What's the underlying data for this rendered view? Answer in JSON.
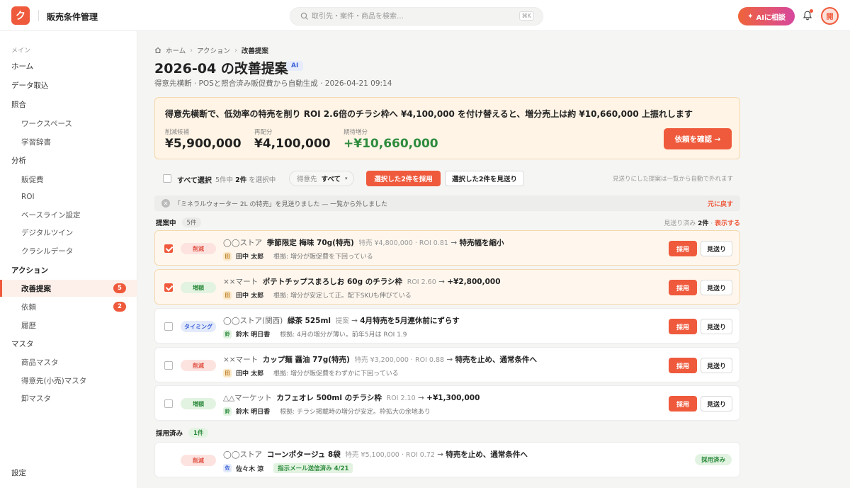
{
  "header": {
    "logo_letter": "ク",
    "app_title": "販売条件管理",
    "search_placeholder": "取引先・案件・商品を検索…",
    "search_kbd": "⌘K",
    "ai_label": "AIに相談",
    "avatar_letter": "開",
    "accent_color": "#ef5a3c"
  },
  "sidebar": {
    "section_main": "メイン",
    "home": "ホーム",
    "data_import": "データ取込",
    "match": "照合",
    "workspace": "ワークスペース",
    "dictionary": "学習辞書",
    "analysis": "分析",
    "promo": "販促費",
    "roi": "ROI",
    "baseline": "ベースライン設定",
    "digital_twin": "デジタルツイン",
    "kurashiru": "クラシルデータ",
    "action": "アクション",
    "improve": "改善提案",
    "improve_badge": "5",
    "request": "依頼",
    "request_badge": "2",
    "history": "履歴",
    "master": "マスタ",
    "product_master": "商品マスタ",
    "customer_master": "得意先(小売)マスタ",
    "wholesale_master": "卸マスタ",
    "settings": "設定"
  },
  "breadcrumb": {
    "home": "ホーム",
    "action": "アクション",
    "current": "改善提案"
  },
  "page": {
    "title": "2026-04 の改善提案",
    "ai_tag": "AI",
    "subtitle": "得意先横断 · POSと照合済み販促費から自動生成 · 2026-04-21 09:14"
  },
  "summary": {
    "headline": "得意先横断で、低効率の特売を削り ROI 2.6倍のチラシ枠へ ¥4,100,000 を付け替えると、増分売上は約 ¥10,660,000 上振れします",
    "m1_label": "削減候補",
    "m1_value": "¥5,900,000",
    "m2_label": "再配分",
    "m2_value": "¥4,100,000",
    "m3_label": "期待増分",
    "m3_value": "+¥10,660,000",
    "confirm_label": "依頼を確認 →"
  },
  "toolbar": {
    "select_all": "すべて選択",
    "count_prefix": "5件中",
    "count_selected": "2件",
    "count_suffix": "を選択中",
    "filter_label": "得意先",
    "filter_value": "すべて",
    "adopt_selected": "選択した2件を採用",
    "skip_selected": "選択した2件を見送り",
    "note": "見送りにした提案は一覧から自動で外れます"
  },
  "toast": {
    "text": "「ミネラルウォーター 2L の特売」を見送りました — 一覧から外しました",
    "undo": "元に戻す"
  },
  "pending": {
    "label": "提案中",
    "count": "5件",
    "skipped_prefix": "見送り済み",
    "skipped_count": "2件",
    "show": "表示する"
  },
  "buttons": {
    "adopt": "採用",
    "skip": "見送り",
    "adopted": "採用済み"
  },
  "rows": [
    {
      "tag": "削減",
      "store": "◯◯ストア",
      "item": "季節限定 梅味 70g(特売)",
      "meta": "特売 ¥4,800,000 · ROI 0.81",
      "action": "特売幅を縮小",
      "person_icon": "田",
      "person": "田中 太郎",
      "reason": "根拠: 増分が販促費を下回っている"
    },
    {
      "tag": "増額",
      "store": "××マート",
      "item": "ポテトチップスまろしお 60g のチラシ枠",
      "meta": "ROI 2.60",
      "action": "+¥2,800,000",
      "person_icon": "田",
      "person": "田中 太郎",
      "reason": "根拠: 増分が安定して正。配下SKUも伸びている"
    },
    {
      "tag": "タイミング",
      "store": "◯◯ストア(関西)",
      "item": "緑茶 525ml",
      "meta": "提案",
      "action": "4月特売を5月連休前にずらす",
      "person_icon": "鈴",
      "person": "鈴木 明日香",
      "reason": "根拠: 4月の増分が薄い。前年5月は ROI 1.9"
    },
    {
      "tag": "削減",
      "store": "××マート",
      "item": "カップ麺 醤油 77g(特売)",
      "meta": "特売 ¥3,200,000 · ROI 0.88",
      "action": "特売を止め、通常条件へ",
      "person_icon": "田",
      "person": "田中 太郎",
      "reason": "根拠: 増分が販促費をわずかに下回っている"
    },
    {
      "tag": "増額",
      "store": "△△マーケット",
      "item": "カフェオレ 500ml のチラシ枠",
      "meta": "ROI 2.10",
      "action": "+¥1,300,000",
      "person_icon": "鈴",
      "person": "鈴木 明日香",
      "reason": "根拠: チラシ掲載時の増分が安定。枠拡大の余地あり"
    }
  ],
  "adopted": {
    "label": "採用済み",
    "count": "1件",
    "row": {
      "tag": "削減",
      "store": "◯◯ストア",
      "item": "コーンポタージュ 8袋",
      "meta": "特売 ¥5,100,000 · ROI 0.72",
      "action": "特売を止め、通常条件へ",
      "person_icon": "佐",
      "person": "佐々木 涼",
      "mail": "指示メール送信済み 4/21"
    }
  }
}
